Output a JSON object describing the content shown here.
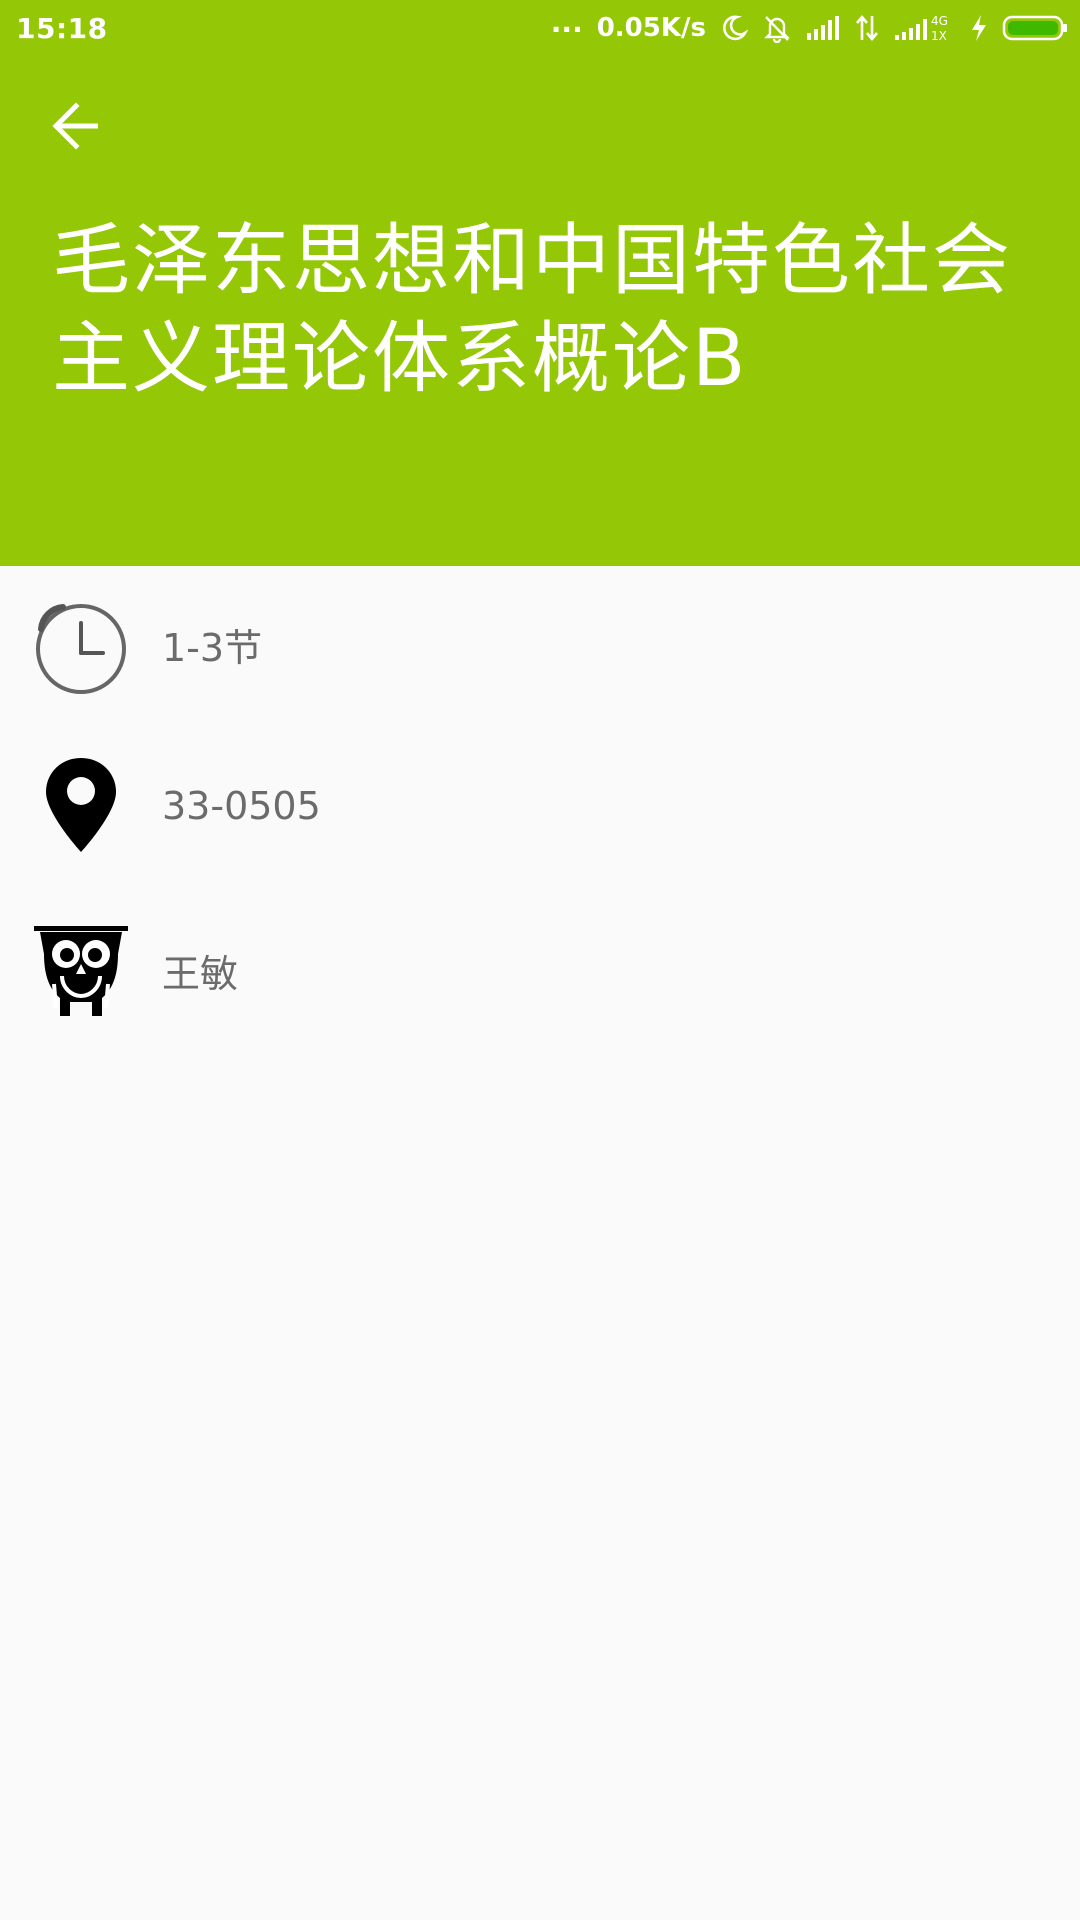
{
  "status_bar": {
    "time": "15:18",
    "dots": "...",
    "net_speed": "0.05K/s",
    "icons": [
      "moon-icon",
      "bell-off-icon",
      "signal-icon",
      "data-arrows-icon",
      "signal-4g-icon",
      "charging-icon",
      "battery-icon"
    ],
    "network_label_top": "4G",
    "network_label_bottom": "1X"
  },
  "header": {
    "background_color": "#94c705",
    "back_icon": "arrow-left-icon",
    "title": "毛泽东思想和中国特色社会主义理论体系概论B"
  },
  "details": {
    "time": {
      "icon": "clock-icon",
      "value": "1-3节"
    },
    "location": {
      "icon": "map-pin-icon",
      "value": "33-0505"
    },
    "teacher": {
      "icon": "owl-teacher-icon",
      "value": "王敏"
    }
  },
  "colors": {
    "accent": "#94c705",
    "detail_text": "#6b6b6b",
    "page_background": "#fafafa"
  }
}
